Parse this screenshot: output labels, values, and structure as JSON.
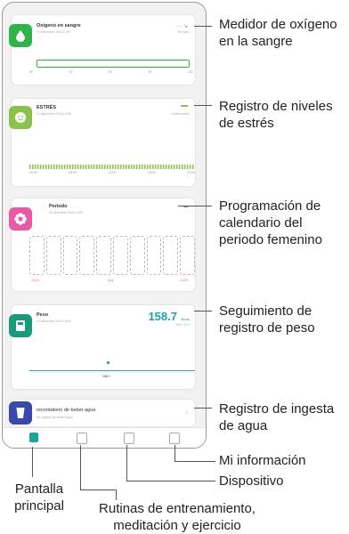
{
  "cards": {
    "oxygen": {
      "title": "Oxígeno en sangre",
      "date": "14 diciembre 2024 14:57",
      "right": "No hubo",
      "scale": [
        "90",
        "92",
        "95",
        "98",
        "100"
      ]
    },
    "stress": {
      "title": "ESTRÉS",
      "date": "14 diciembre 2024 14:58",
      "right": "Estrés medio",
      "ticks": [
        "00:00",
        "06:00",
        "12:00",
        "18:00",
        "23:59"
      ]
    },
    "period": {
      "title": "Periodo",
      "date": "14 diciembre 2024 14:57",
      "left_date": "12/13",
      "mid_date": "Hoy",
      "right_date": "12/23"
    },
    "weight": {
      "title": "Peso",
      "date": "14 diciembre 2024 15:02",
      "value": "158.7",
      "unit": "libras",
      "sub": "IMC: 25.9",
      "point_label": "158.7"
    },
    "water": {
      "title": "recordatorio de beber agua",
      "sub": "No registró de beber agua"
    }
  },
  "annotations": {
    "oxygen": "Medidor de oxígeno en la sangre",
    "stress": "Registro de niveles de estrés",
    "period": "Programación de calendario del periodo femenino",
    "weight": "Seguimiento de registro de peso",
    "water": "Registro de ingesta de agua",
    "myinfo": "Mi información",
    "device": "Dispositivo",
    "home": "Pantalla principal",
    "routines": "Rutinas de entrenamiento, meditación y ejercicio"
  },
  "colors": {
    "oxygen": "#2fb34a",
    "stress": "#8bc34a",
    "period": "#e75aa8",
    "weight": "#1a9a7a",
    "water": "#3949ab",
    "accent": "#1aa4a0"
  }
}
